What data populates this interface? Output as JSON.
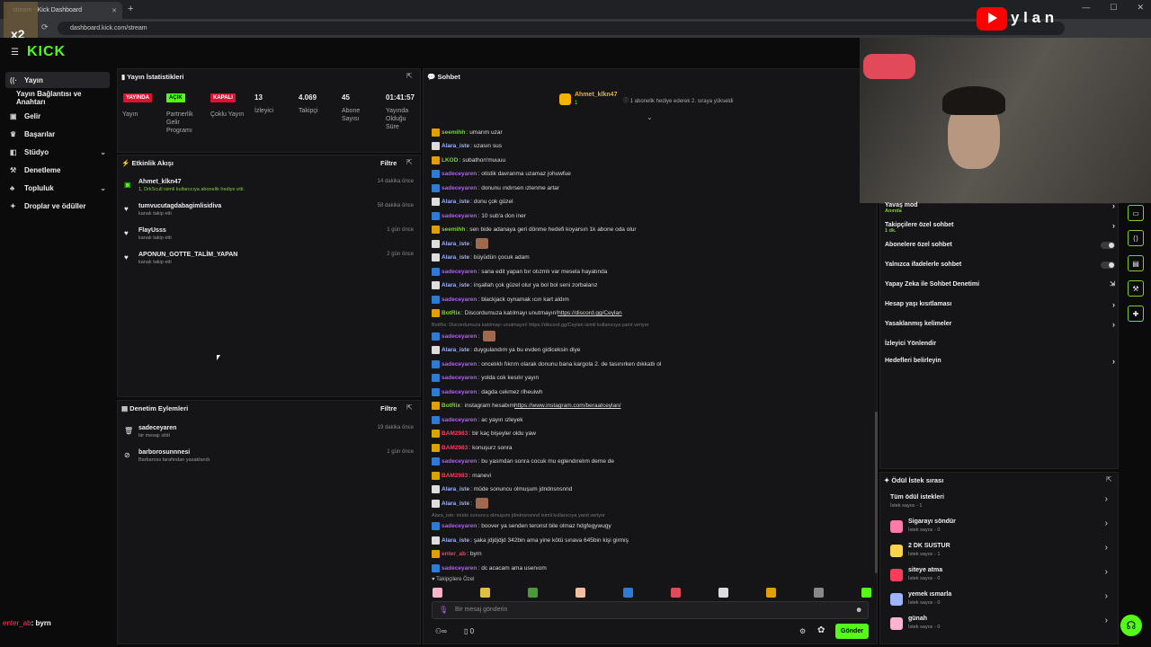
{
  "browser": {
    "tab_title": "stream - Kick Dashboard",
    "url": "dashboard.kick.com/stream"
  },
  "logo": "KICK",
  "overlay": {
    "channel_badge": "x2",
    "yt_text": "y l a n"
  },
  "sidebar": {
    "items": [
      {
        "label": "Yayın",
        "icon": "broadcast-icon"
      },
      {
        "label": "Yayın Bağlantısı ve Anahtarı",
        "icon": ""
      },
      {
        "label": "Gelir",
        "icon": "wallet-icon"
      },
      {
        "label": "Başarılar",
        "icon": "trophy-icon"
      },
      {
        "label": "Stüdyo",
        "icon": "studio-icon"
      },
      {
        "label": "Denetleme",
        "icon": "hammer-icon"
      },
      {
        "label": "Topluluk",
        "icon": "community-icon"
      },
      {
        "label": "Droplar ve ödüller",
        "icon": "gift-icon"
      }
    ],
    "footer_user": "enter_ab",
    "footer_msg": ": byrn"
  },
  "stats": {
    "title": "Yayın İstatistikleri",
    "items": [
      {
        "badge": "YAYINDA",
        "label": "Yayın"
      },
      {
        "badge": "AÇIK",
        "label": "Partnerlik Gelir Programı"
      },
      {
        "badge": "KAPALI",
        "label": "Çoklu Yayın"
      },
      {
        "value": "13",
        "label": "İzleyici"
      },
      {
        "value": "4.069",
        "label": "Takipçi"
      },
      {
        "value": "45",
        "label": "Abone Sayısı"
      },
      {
        "value": "01:41:57",
        "label": "Yayında Olduğu Süre"
      }
    ]
  },
  "activity": {
    "title": "Etkinlik Akışı",
    "filter": "Filtre",
    "items": [
      {
        "name": "Ahmet_klkn47",
        "sub": "1, DrkScull isimli kullanıcıya abonelik hediye etti.",
        "time": "14 dakika önce"
      },
      {
        "name": "tumvucutagdabagimlisidiva",
        "sub": "kanalı takip etti",
        "time": "58 dakika önce"
      },
      {
        "name": "FlayUsss",
        "sub": "kanalı takip etti",
        "time": "1 gün önce"
      },
      {
        "name": "APONUN_GOTTE_TALİM_YAPAN",
        "sub": "kanalı takip etti",
        "time": "2 gün önce"
      }
    ]
  },
  "moderation": {
    "title": "Denetim Eylemleri",
    "filter": "Filtre",
    "items": [
      {
        "name": "sadeceyaren",
        "sub": "bir mesajı sildi",
        "time": "19 dakika önce"
      },
      {
        "name": "barborosunnnesi",
        "sub": "Barbaross tarafından yasaklandı",
        "time": "1 gün önce"
      }
    ]
  },
  "chat": {
    "title": "Sohbet",
    "pinned_user": "Ahmet_klkn47",
    "pinned_count": "1",
    "pinned_text": "1 abonelik hediye ederek 2. sıraya yükseldi",
    "messages": [
      {
        "u": "seemihh",
        "c": "#7fcf3a",
        "t": "umarım uzar"
      },
      {
        "u": "Alara_iste",
        "c": "#9fb3ff",
        "t": "uzasın sus"
      },
      {
        "u": "LKOD",
        "c": "#7fcf3a",
        "t": "subathon'muuuu"
      },
      {
        "u": "sadeceyaren",
        "c": "#b45cff",
        "t": "otistik davranma uzamaz johuwfue"
      },
      {
        "u": "sadeceyaren",
        "c": "#b45cff",
        "t": "donunu ındırsen ızlenme artar"
      },
      {
        "u": "Alara_iste",
        "c": "#9fb3ff",
        "t": "donu çok güzel"
      },
      {
        "u": "sadeceyaren",
        "c": "#b45cff",
        "t": "10 sub'a don iner"
      },
      {
        "u": "seemihh",
        "c": "#7fcf3a",
        "t": "sen bide adanaya geri dönme hedefi koyarsın 1k abone oda olur"
      },
      {
        "u": "Alara_iste",
        "c": "#9fb3ff",
        "t": ""
      },
      {
        "u": "Alara_iste",
        "c": "#9fb3ff",
        "t": "büyüdün çocuk adam"
      },
      {
        "u": "sadeceyaren",
        "c": "#b45cff",
        "t": "sana edit yapan bır otızmlı var mesela hayatında"
      },
      {
        "u": "Alara_iste",
        "c": "#9fb3ff",
        "t": "inşallah çok güzel olur ya bol bol seni zorbalarız"
      },
      {
        "u": "sadeceyaren",
        "c": "#b45cff",
        "t": "blackjack oynamak ıcın kart aldım"
      },
      {
        "u": "BotRix",
        "c": "#7fcf3a",
        "t": "Discordumuza katılmayı unutmayın! ",
        "link": "https://discord.gg/Ceylan"
      },
      {
        "reply": "BotRix: Discordumuza katılmayı unutmayın! https://discord.gg/Ceylan isimli kullanıcıya yanıt veriyor"
      },
      {
        "u": "sadeceyaren",
        "c": "#b45cff",
        "t": ""
      },
      {
        "u": "Alara_iste",
        "c": "#9fb3ff",
        "t": "duygulandım ya bu evden gidiceksin diye"
      },
      {
        "u": "sadeceyaren",
        "c": "#b45cff",
        "t": "oncelıklı fıkrım olarak donunu bana kargola 2. de tasınırken dıkkatlı ol"
      },
      {
        "u": "sadeceyaren",
        "c": "#b45cff",
        "t": "yolda cok kesılır yayın"
      },
      {
        "u": "sadeceyaren",
        "c": "#b45cff",
        "t": "dagda cekmez rlheuiwh"
      },
      {
        "u": "BotRix",
        "c": "#7fcf3a",
        "t": "instagram hesabım ",
        "link": "https://www.instagram.com/beraatceylan/"
      },
      {
        "u": "sadeceyaren",
        "c": "#b45cff",
        "t": "ac yayın ızleyek"
      },
      {
        "u": "BAM2983",
        "c": "#ff3b5c",
        "t": "bir kaç bişeyler oldu yaw"
      },
      {
        "u": "BAM2983",
        "c": "#ff3b5c",
        "t": "konuşurz sonra"
      },
      {
        "u": "sadeceyaren",
        "c": "#b45cff",
        "t": "bu yasmdan sonra cocuk mu eglendırelım deme de"
      },
      {
        "u": "BAM2983",
        "c": "#ff3b5c",
        "t": "manevi"
      },
      {
        "u": "Alara_iste",
        "c": "#9fb3ff",
        "t": "müde sonuncu olmuşum jdndnsnsnnd"
      },
      {
        "u": "Alara_iste",
        "c": "#9fb3ff",
        "t": ""
      },
      {
        "reply": "Alara_iste: müde sonuncu olmuşum jdndnsnsnnd isimli kullanıcıya yanıt veriyor"
      },
      {
        "u": "sadeceyaren",
        "c": "#b45cff",
        "t": "boover ya senden teronst bile olmaz hdgfegywugy"
      },
      {
        "u": "Alara_iste",
        "c": "#9fb3ff",
        "t": "şaka jdjdjdjd 342bin ama yine kötü sınava 645bin kişi girmiş"
      },
      {
        "u": "enter_ab",
        "c": "#ff3b5c",
        "t": "byrn"
      },
      {
        "u": "sadeceyaren",
        "c": "#b45cff",
        "t": "dc acacam ama usenıom"
      }
    ],
    "followers_only": "Takipçilere Özel",
    "input_placeholder": "Bir mesaj gönderin",
    "viewers_inf": "∞",
    "count0": "0",
    "send": "Gönder"
  },
  "settings": {
    "items": [
      {
        "label": "Yavaş mod",
        "sub": "Anında",
        "type": "arrow"
      },
      {
        "label": "Takipçilere özel sohbet",
        "sub": "1 dk.",
        "type": "arrow"
      },
      {
        "label": "Abonelere özel sohbet",
        "sub": "",
        "type": "toggle"
      },
      {
        "label": "Yalnızca ifadelerle sohbet",
        "sub": "",
        "type": "toggle"
      },
      {
        "label": "Yapay Zeka ile Sohbet Denetimi",
        "sub": "",
        "type": "ext"
      },
      {
        "label": "Hesap yaşı kısıtlaması",
        "sub": "",
        "type": "arrow"
      },
      {
        "label": "Yasaklanmış kelimeler",
        "sub": "",
        "type": "arrow"
      },
      {
        "label": "İzleyici Yönlendir",
        "sub": "",
        "type": "none"
      },
      {
        "label": "Hedefleri belirleyin",
        "sub": "",
        "type": "arrow"
      }
    ]
  },
  "rewards": {
    "title": "Ödül İstek sırası",
    "items": [
      {
        "name": "Tüm ödül istekleri",
        "sub": "İstek sayısı - 1",
        "color": ""
      },
      {
        "name": "Sigarayı söndür",
        "sub": "İstek sayısı - 0",
        "color": "#ff7aa8"
      },
      {
        "name": "2 DK SUSTUR",
        "sub": "İstek sayısı - 1",
        "color": "#ffd34d"
      },
      {
        "name": "siteye atma",
        "sub": "İstek sayısı - 0",
        "color": "#ff3b5c"
      },
      {
        "name": "yemek ısmarla",
        "sub": "İstek sayısı - 0",
        "color": "#9fb3ff"
      },
      {
        "name": "günah",
        "sub": "İstek sayısı - 0",
        "color": "#ffb3d0"
      }
    ]
  }
}
